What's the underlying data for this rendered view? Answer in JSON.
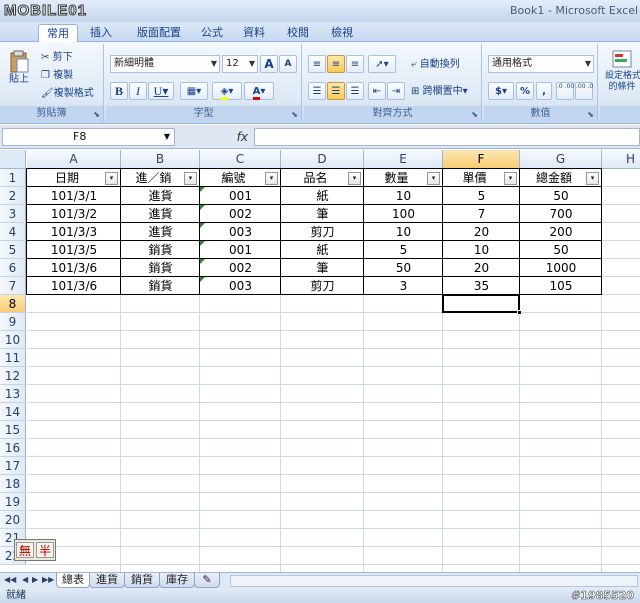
{
  "logo": "MOBILE01",
  "window_title": "Book1 - Microsoft Excel",
  "tabs": [
    "常用",
    "插入",
    "版面配置",
    "公式",
    "資料",
    "校閱",
    "檢視"
  ],
  "clipboard": {
    "paste": "貼上",
    "cut": "剪下",
    "copy": "複製",
    "format_painter": "複製格式",
    "label": "剪貼簿"
  },
  "font": {
    "name": "新細明體",
    "size": "12",
    "bold": "B",
    "italic": "I",
    "underline": "U",
    "grow": "A",
    "shrink": "A",
    "font_color_letter": "A",
    "label": "字型"
  },
  "alignment": {
    "wrap": "自動換列",
    "merge": "跨欄置中",
    "label": "對齊方式"
  },
  "number": {
    "format": "通用格式",
    "currency": "$",
    "percent": "%",
    "comma": ",",
    "inc_decimal": ".0 .00",
    "dec_decimal": ".00 .0",
    "label": "數值"
  },
  "styles": {
    "conditional": "設定格式",
    "conditional2": "的條件"
  },
  "name_box": "F8",
  "fx": "fx",
  "columns": [
    "A",
    "B",
    "C",
    "D",
    "E",
    "F",
    "G",
    "H"
  ],
  "rows": [
    "1",
    "2",
    "3",
    "4",
    "5",
    "6",
    "7",
    "8",
    "9",
    "10",
    "11",
    "12",
    "13",
    "14",
    "15",
    "16",
    "17",
    "18",
    "19",
    "20",
    "21",
    "22"
  ],
  "table": {
    "headers": [
      "日期",
      "進／銷",
      "編號",
      "品名",
      "數量",
      "單價",
      "總金額"
    ],
    "filter_glyph": "▾",
    "data": [
      [
        "101/3/1",
        "進貨",
        "001",
        "紙",
        "10",
        "5",
        "50"
      ],
      [
        "101/3/2",
        "進貨",
        "002",
        "筆",
        "100",
        "7",
        "700"
      ],
      [
        "101/3/3",
        "進貨",
        "003",
        "剪刀",
        "10",
        "20",
        "200"
      ],
      [
        "101/3/5",
        "銷貨",
        "001",
        "紙",
        "5",
        "10",
        "50"
      ],
      [
        "101/3/6",
        "銷貨",
        "002",
        "筆",
        "50",
        "20",
        "1000"
      ],
      [
        "101/3/6",
        "銷貨",
        "003",
        "剪刀",
        "3",
        "35",
        "105"
      ]
    ]
  },
  "ime": [
    "無",
    "半"
  ],
  "sheets": [
    "總表",
    "進貨",
    "銷貨",
    "庫存"
  ],
  "status": "就緒",
  "watermark": "#1985520",
  "colors": {
    "accent": "#15428b",
    "selected_header": "#f9cc72",
    "ribbon": "#dfe9f5"
  }
}
